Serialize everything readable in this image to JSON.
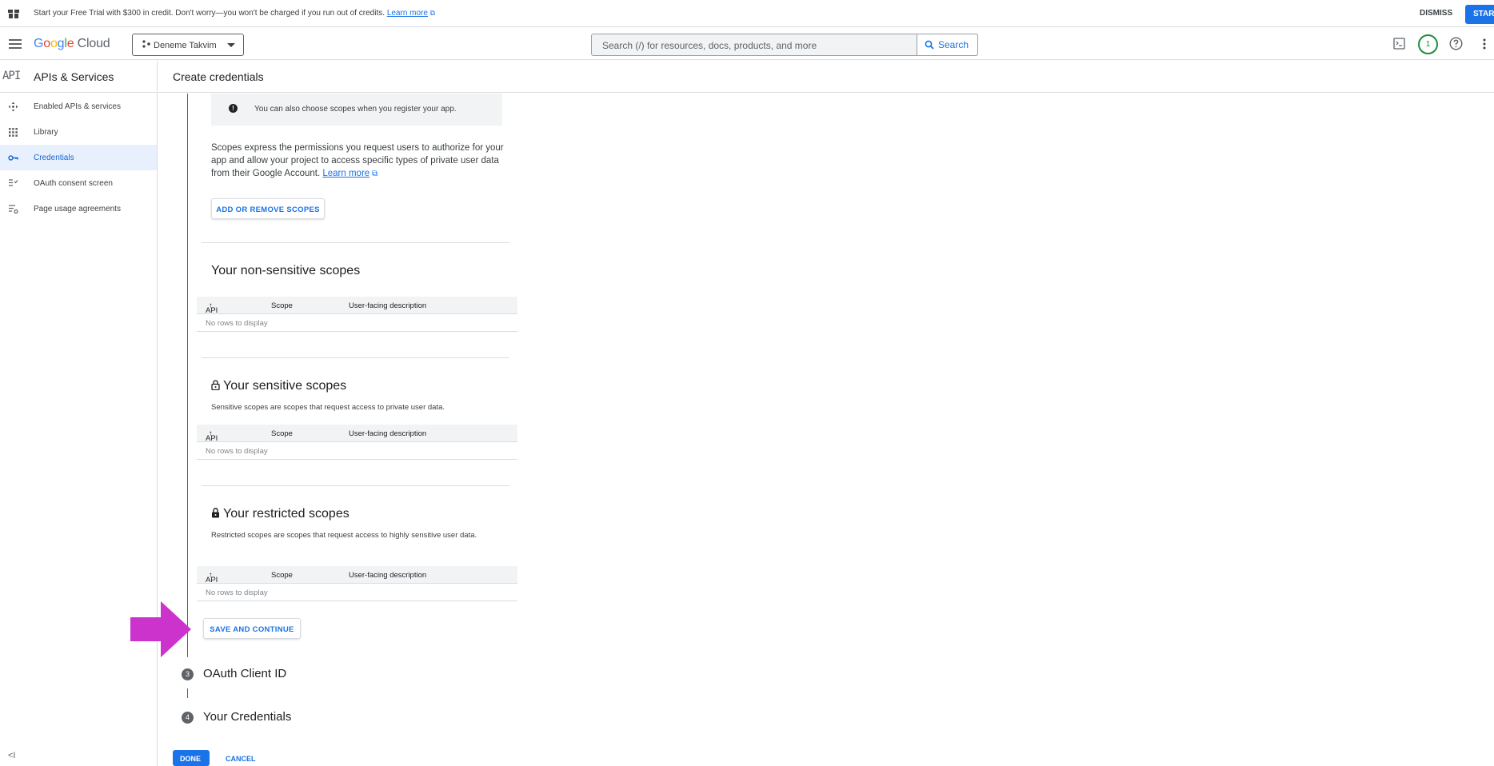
{
  "banner": {
    "message": "Start your Free Trial with $300 in credit. Don't worry—you won't be charged if you run out of credits.",
    "learn_more": "Learn more",
    "dismiss": "DISMISS",
    "start": "START"
  },
  "topbar": {
    "logo_google": [
      "G",
      "o",
      "o",
      "g",
      "l",
      "e"
    ],
    "logo_cloud": "Cloud",
    "project": "Deneme Takvim",
    "search_placeholder": "Search (/) for resources, docs, products, and more",
    "search_button": "Search",
    "notifications_count": "1"
  },
  "subhead": {
    "api_badge": "API",
    "service": "APIs & Services",
    "page_title": "Create credentials"
  },
  "sidebar": {
    "items": [
      {
        "label": "Enabled APIs & services",
        "icon": "enabled-apis-icon",
        "active": false
      },
      {
        "label": "Library",
        "icon": "library-icon",
        "active": false
      },
      {
        "label": "Credentials",
        "icon": "key-icon",
        "active": true
      },
      {
        "label": "OAuth consent screen",
        "icon": "consent-icon",
        "active": false
      },
      {
        "label": "Page usage agreements",
        "icon": "agreements-icon",
        "active": false
      }
    ],
    "collapse": "<I"
  },
  "main": {
    "info_text": "You can also choose scopes when you register your app.",
    "scopes_desc": "Scopes express the permissions you request users to authorize for your app and allow your project to access specific types of private user data from their Google Account.",
    "scopes_learn_more": "Learn more",
    "add_remove_scopes": "ADD OR REMOVE SCOPES",
    "table_headers": {
      "api": "API",
      "scope": "Scope",
      "description": "User-facing description"
    },
    "empty_row": "No rows to display",
    "non_sensitive": {
      "title": "Your non-sensitive scopes"
    },
    "sensitive": {
      "title": "Your sensitive scopes",
      "desc": "Sensitive scopes are scopes that request access to private user data."
    },
    "restricted": {
      "title": "Your restricted scopes",
      "desc": "Restricted scopes are scopes that request access to highly sensitive user data."
    },
    "save_continue": "SAVE AND CONTINUE",
    "steps": [
      {
        "number": "3",
        "label": "OAuth Client ID"
      },
      {
        "number": "4",
        "label": "Your Credentials"
      }
    ],
    "done": "DONE",
    "cancel": "CANCEL"
  },
  "colors": {
    "accent": "#1a73e8",
    "annotation_arrow": "#cc33cc"
  }
}
